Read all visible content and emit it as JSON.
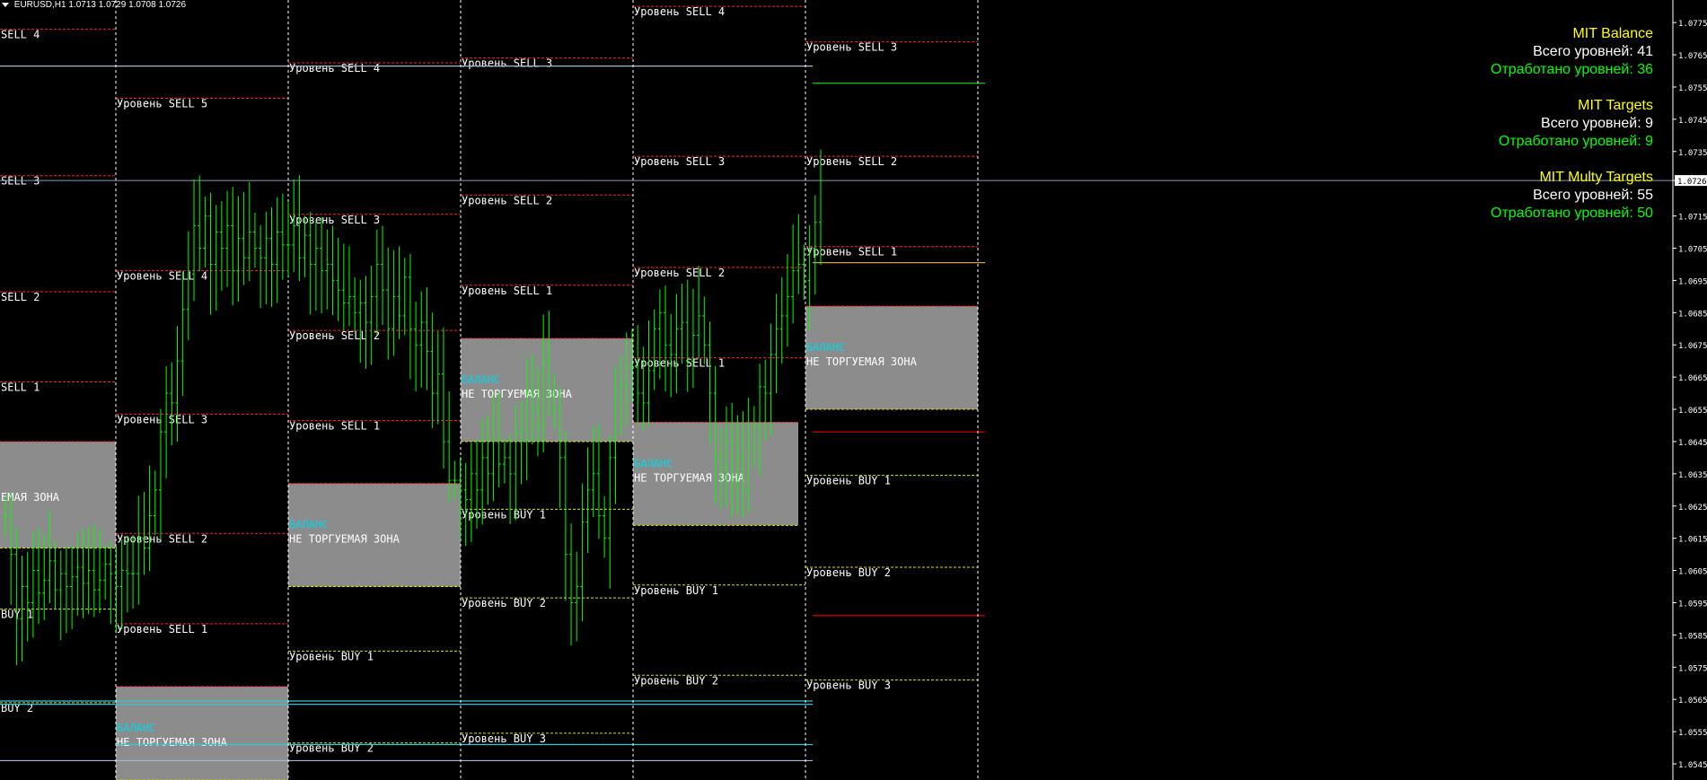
{
  "header": {
    "symbol_timeframe": "EURUSD,H1",
    "ohlc": "1.0713 1.0729 1.0708 1.0726"
  },
  "info_panel": [
    {
      "title": "MIT Balance",
      "total": "Всего уровней: 41",
      "done": "Отработано уровней: 36"
    },
    {
      "title": "MIT Targets",
      "total": "Всего уровней: 9",
      "done": "Отработано уровней: 9"
    },
    {
      "title": "MIT Multy Targets",
      "total": "Всего уровней: 55",
      "done": "Отработано уровней: 50"
    }
  ],
  "colors": {
    "background": "#000000",
    "sell_line": "#ff2020",
    "buy_line": "#e0e000",
    "zone_fill": "#8c8c8c",
    "balance_label": "#00d8e8",
    "candle": "#00ff00",
    "separator": "#ffffff",
    "info_title": "#ffff00",
    "info_done": "#00ff00",
    "current_price_line": "#8899bb",
    "target_green": "#00cc00",
    "target_red": "#e00000",
    "target_orange": "#d89a50"
  },
  "chart_data": {
    "type": "candlestick",
    "symbol": "EURUSD",
    "timeframe": "H1",
    "current_price": 1.0726,
    "ylim": [
      1.054,
      1.0782
    ],
    "price_ticks": [
      1.0775,
      1.0765,
      1.0755,
      1.0745,
      1.0735,
      1.0726,
      1.0715,
      1.0705,
      1.0695,
      1.0685,
      1.0675,
      1.0665,
      1.0655,
      1.0645,
      1.0635,
      1.0625,
      1.0615,
      1.0605,
      1.0595,
      1.0585,
      1.0575,
      1.0565,
      1.0555,
      1.0545
    ],
    "current_price_label": "1.0726",
    "balance_label": "БАЛАНС",
    "zone_label": "НЕ ТОРГУЕМАЯ ЗОНА",
    "sessions": [
      {
        "zone": [
          1.0612,
          1.0645
        ],
        "zone_text": "ЕМАЯ ЗОНА",
        "balance": false,
        "levels": [
          {
            "text": "SELL 4",
            "price": 1.0773,
            "type": "sell"
          },
          {
            "text": "SELL 3",
            "price": 1.07275,
            "type": "sell"
          },
          {
            "text": "SELL 2",
            "price": 1.06915,
            "type": "sell"
          },
          {
            "text": "SELL 1",
            "price": 1.06635,
            "type": "sell"
          },
          {
            "text": "BUY 1",
            "price": 1.0593,
            "type": "buy"
          },
          {
            "text": "BUY 2",
            "price": 1.0564,
            "type": "buy"
          }
        ]
      },
      {
        "zone": [
          1.054,
          1.0569
        ],
        "balance": true,
        "levels": [
          {
            "text": "Уровень SELL 5",
            "price": 1.07515,
            "type": "sell"
          },
          {
            "text": "Уровень SELL 4",
            "price": 1.0698,
            "type": "sell"
          },
          {
            "text": "Уровень SELL 3",
            "price": 1.06535,
            "type": "sell"
          },
          {
            "text": "Уровень SELL 2",
            "price": 1.06165,
            "type": "sell"
          },
          {
            "text": "Уровень SELL 1",
            "price": 1.05885,
            "type": "sell"
          }
        ]
      },
      {
        "zone": [
          1.06,
          1.0632
        ],
        "balance": true,
        "levels": [
          {
            "text": "Уровень SELL 4",
            "price": 1.07625,
            "type": "sell"
          },
          {
            "text": "Уровень SELL 3",
            "price": 1.07155,
            "type": "sell"
          },
          {
            "text": "Уровень SELL 2",
            "price": 1.06795,
            "type": "sell"
          },
          {
            "text": "Уровень SELL 1",
            "price": 1.06515,
            "type": "sell"
          },
          {
            "text": "Уровень BUY 1",
            "price": 1.058,
            "type": "buy"
          },
          {
            "text": "Уровень BUY 2",
            "price": 1.05515,
            "type": "buy"
          }
        ]
      },
      {
        "zone": [
          1.0645,
          1.0677
        ],
        "balance": true,
        "levels": [
          {
            "text": "Уровень SELL 3",
            "price": 1.0764,
            "type": "sell"
          },
          {
            "text": "Уровень SELL 2",
            "price": 1.07215,
            "type": "sell"
          },
          {
            "text": "Уровень SELL 1",
            "price": 1.06935,
            "type": "sell"
          },
          {
            "text": "Уровень BUY 1",
            "price": 1.0624,
            "type": "buy"
          },
          {
            "text": "Уровень BUY 2",
            "price": 1.05965,
            "type": "buy"
          },
          {
            "text": "Уровень BUY 3",
            "price": 1.05545,
            "type": "buy"
          }
        ]
      },
      {
        "zone": [
          1.0619,
          1.0651
        ],
        "balance": true,
        "levels": [
          {
            "text": "Уровень SELL 4",
            "price": 1.078,
            "type": "sell"
          },
          {
            "text": "Уровень SELL 3",
            "price": 1.07335,
            "type": "sell"
          },
          {
            "text": "Уровень SELL 2",
            "price": 1.0699,
            "type": "sell"
          },
          {
            "text": "Уровень SELL 1",
            "price": 1.0671,
            "type": "sell"
          },
          {
            "text": "Уровень BUY 1",
            "price": 1.06005,
            "type": "buy"
          },
          {
            "text": "Уровень BUY 2",
            "price": 1.05725,
            "type": "buy"
          }
        ]
      },
      {
        "zone": [
          1.0655,
          1.0687
        ],
        "balance": true,
        "levels": [
          {
            "text": "Уровень SELL 3",
            "price": 1.0769,
            "type": "sell"
          },
          {
            "text": "Уровень SELL 2",
            "price": 1.07335,
            "type": "sell"
          },
          {
            "text": "Уровень SELL 1",
            "price": 1.07055,
            "type": "sell"
          },
          {
            "text": "Уровень BUY 1",
            "price": 1.06345,
            "type": "buy"
          },
          {
            "text": "Уровень BUY 2",
            "price": 1.0606,
            "type": "buy"
          },
          {
            "text": "Уровень BUY 3",
            "price": 1.0571,
            "type": "buy"
          }
        ]
      }
    ],
    "horizontal_lines": [
      {
        "price": 1.07615,
        "color": "#a8b8d0",
        "from_session": 0,
        "to_session": 5
      },
      {
        "price": 1.05645,
        "color": "#30c8d8",
        "from_session": 0,
        "to_session": 5
      },
      {
        "price": 1.05635,
        "color": "#30c8d8",
        "from_session": 0,
        "to_session": 5
      },
      {
        "price": 1.0551,
        "color": "#30c8d8",
        "from_session": 1,
        "to_session": 5
      },
      {
        "price": 1.0546,
        "color": "#a8b8d0",
        "from_session": 0,
        "to_session": 5
      },
      {
        "price": 1.07562,
        "color": "#00cc00",
        "from_session": 5,
        "to_session": 6
      },
      {
        "price": 1.07005,
        "color": "#d89a50",
        "from_session": 5,
        "to_session": 6
      },
      {
        "price": 1.0648,
        "color": "#e00000",
        "from_session": 5,
        "to_session": 6
      },
      {
        "price": 1.0591,
        "color": "#e00000",
        "from_session": 5,
        "to_session": 6
      }
    ],
    "closes": [
      1.0622,
      1.061,
      1.059,
      1.06,
      1.0595,
      1.0605,
      1.0598,
      1.0602,
      1.0608,
      1.0599,
      1.0604,
      1.06,
      1.0603,
      1.0606,
      1.0601,
      1.0605,
      1.0599,
      1.0602,
      1.0607,
      1.0604,
      1.06,
      1.0605,
      1.0604,
      1.0604,
      1.0615,
      1.0612,
      1.0622,
      1.063,
      1.0648,
      1.066,
      1.0657,
      1.067,
      1.0686,
      1.0697,
      1.0712,
      1.0705,
      1.0715,
      1.07,
      1.071,
      1.0705,
      1.0712,
      1.0698,
      1.0708,
      1.0702,
      1.071,
      1.0705,
      1.0702,
      1.0708,
      1.07,
      1.071,
      1.0706,
      1.0706,
      1.0712,
      1.0702,
      1.0709,
      1.07,
      1.0705,
      1.0698,
      1.07,
      1.0695,
      1.0692,
      1.0688,
      1.069,
      1.0685,
      1.0688,
      1.0682,
      1.069,
      1.07,
      1.0692,
      1.068,
      1.069,
      1.0684,
      1.0696,
      1.068,
      1.0675,
      1.0682,
      1.0673,
      1.066,
      1.0666,
      1.0645,
      1.0633,
      1.0633,
      1.063,
      1.0627,
      1.0635,
      1.063,
      1.064,
      1.0635,
      1.0645,
      1.0638,
      1.064,
      1.0635,
      1.0648,
      1.0645,
      1.066,
      1.0655,
      1.065,
      1.067,
      1.066,
      1.0655,
      1.064,
      1.061,
      1.0595,
      1.06,
      1.062,
      1.063,
      1.0635,
      1.0622,
      1.0615,
      1.064,
      1.066,
      1.0662,
      1.0668,
      1.0668,
      1.066,
      1.0657,
      1.0667,
      1.068,
      1.0685,
      1.0675,
      1.0672,
      1.068,
      1.0682,
      1.067,
      1.0678,
      1.0684,
      1.0675,
      1.066,
      1.064,
      1.0637,
      1.0645,
      1.0632,
      1.064,
      1.063,
      1.0643,
      1.065,
      1.0662,
      1.066,
      1.0672,
      1.068,
      1.0684,
      1.069,
      1.0698,
      1.07,
      1.0695,
      1.0705,
      1.0713,
      1.0726
    ]
  }
}
